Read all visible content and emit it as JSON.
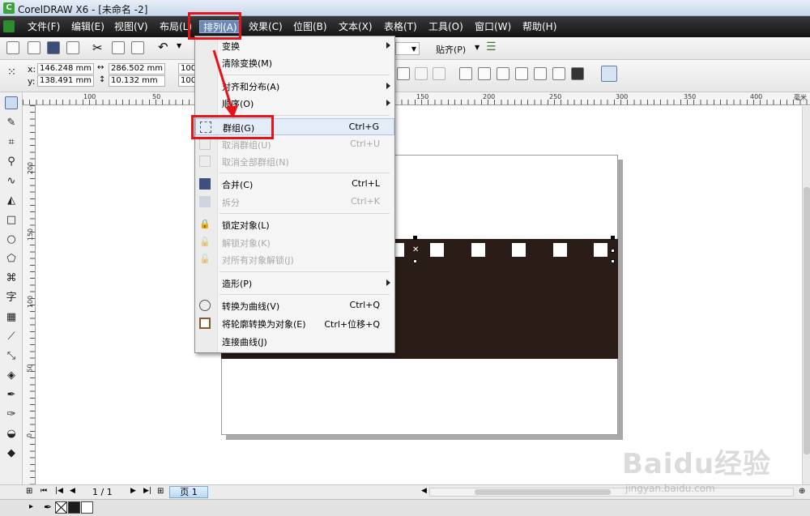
{
  "window": {
    "title": "CorelDRAW X6 - [未命名 -2]"
  },
  "menubar": {
    "items": [
      {
        "label": "文件(F)"
      },
      {
        "label": "编辑(E)"
      },
      {
        "label": "视图(V)"
      },
      {
        "label": "布局(L)"
      },
      {
        "label": "排列(A)"
      },
      {
        "label": "效果(C)"
      },
      {
        "label": "位图(B)"
      },
      {
        "label": "文本(X)"
      },
      {
        "label": "表格(T)"
      },
      {
        "label": "工具(O)"
      },
      {
        "label": "窗口(W)"
      },
      {
        "label": "帮助(H)"
      }
    ]
  },
  "toolbar": {
    "snap_label": "贴齐(P)",
    "zoom_value": "100"
  },
  "property_bar": {
    "x_label": "x:",
    "x_value": "146.248 mm",
    "y_label": "y:",
    "y_value": "138.491 mm",
    "width_value": "286.502 mm",
    "height_value": "10.132 mm",
    "scale_w": "100",
    "scale_h": "100"
  },
  "ruler_h": {
    "ticks": [
      "100",
      "50",
      "150",
      "200",
      "250",
      "300",
      "350",
      "400",
      "毫米"
    ]
  },
  "ruler_v": {
    "ticks": [
      "200",
      "150",
      "100",
      "50",
      "0"
    ]
  },
  "arrange_menu": {
    "items": [
      {
        "label": "变换",
        "shortcut": "",
        "submenu": true,
        "enabled": true
      },
      {
        "label": "清除变换(M)",
        "shortcut": "",
        "submenu": false,
        "enabled": true
      },
      {
        "label": "对齐和分布(A)",
        "shortcut": "",
        "submenu": true,
        "enabled": true
      },
      {
        "label": "顺序(O)",
        "shortcut": "",
        "submenu": true,
        "enabled": true
      },
      {
        "label": "群组(G)",
        "shortcut": "Ctrl+G",
        "submenu": false,
        "enabled": true,
        "highlighted": true
      },
      {
        "label": "取消群组(U)",
        "shortcut": "Ctrl+U",
        "submenu": false,
        "enabled": false
      },
      {
        "label": "取消全部群组(N)",
        "shortcut": "",
        "submenu": false,
        "enabled": false
      },
      {
        "label": "合并(C)",
        "shortcut": "Ctrl+L",
        "submenu": false,
        "enabled": true
      },
      {
        "label": "拆分",
        "shortcut": "Ctrl+K",
        "submenu": false,
        "enabled": false
      },
      {
        "label": "锁定对象(L)",
        "shortcut": "",
        "submenu": false,
        "enabled": true
      },
      {
        "label": "解锁对象(K)",
        "shortcut": "",
        "submenu": false,
        "enabled": false
      },
      {
        "label": "对所有对象解锁(J)",
        "shortcut": "",
        "submenu": false,
        "enabled": false
      },
      {
        "label": "造形(P)",
        "shortcut": "",
        "submenu": true,
        "enabled": true
      },
      {
        "label": "转换为曲线(V)",
        "shortcut": "Ctrl+Q",
        "submenu": false,
        "enabled": true
      },
      {
        "label": "将轮廓转换为对象(E)",
        "shortcut": "Ctrl+位移+Q",
        "submenu": false,
        "enabled": true
      },
      {
        "label": "连接曲线(J)",
        "shortcut": "",
        "submenu": false,
        "enabled": true
      }
    ]
  },
  "toolbox": {
    "text_tool_glyph": "字"
  },
  "pagebar": {
    "page_count": "1 / 1",
    "page_tab": "页 1"
  },
  "watermark": {
    "logo": "Baidu经验",
    "url": "jingyan.baidu.com"
  },
  "colors": {
    "accent_red": "#e5131a",
    "menubar_bg": "#1e1e1e",
    "dark_rect": "#2a1d18"
  }
}
